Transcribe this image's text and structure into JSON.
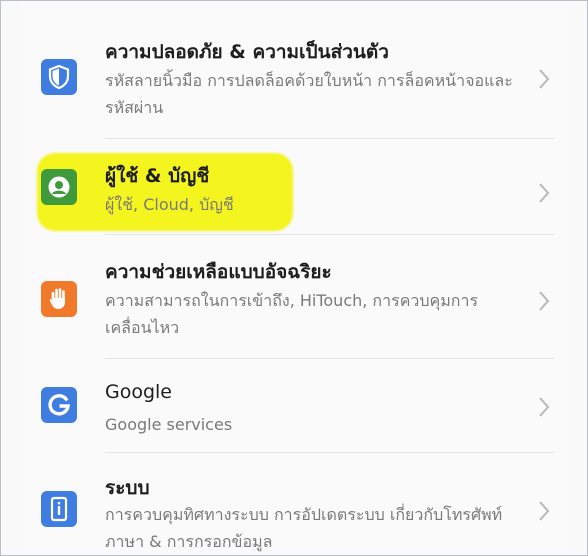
{
  "items": [
    {
      "title": "ความปลอดภัย & ความเป็นส่วนตัว",
      "subtitle": "รหัสลายนิ้วมือ การปลดล็อคด้วยใบหน้า การล็อคหน้าจอและรหัสผ่าน",
      "icon": "shield-icon",
      "icon_color": "#3f7de0"
    },
    {
      "title": "ผู้ใช้ & บัญชี",
      "subtitle": "ผู้ใช้, Cloud, บัญชี",
      "icon": "user-account-icon",
      "icon_color": "#3f9a3b",
      "highlighted": true,
      "highlight_color": "#f4f41e"
    },
    {
      "title": "ความช่วยเหลือแบบอัจฉริยะ",
      "subtitle": "ความสามารถในการเข้าถึง, HiTouch, การควบคุมการเคลื่อนไหว",
      "icon": "hand-icon",
      "icon_color": "#f07a2a"
    },
    {
      "title": "Google",
      "subtitle": "Google services",
      "icon": "google-g-icon",
      "icon_color": "#3f7de0"
    },
    {
      "title": "ระบบ",
      "subtitle": "การควบคุมทิศทางระบบ การอัปเดตระบบ เกี่ยวกับโทรศัพท์ ภาษา & การกรอกข้อมูล",
      "icon": "info-phone-icon",
      "icon_color": "#3f7de0"
    }
  ]
}
